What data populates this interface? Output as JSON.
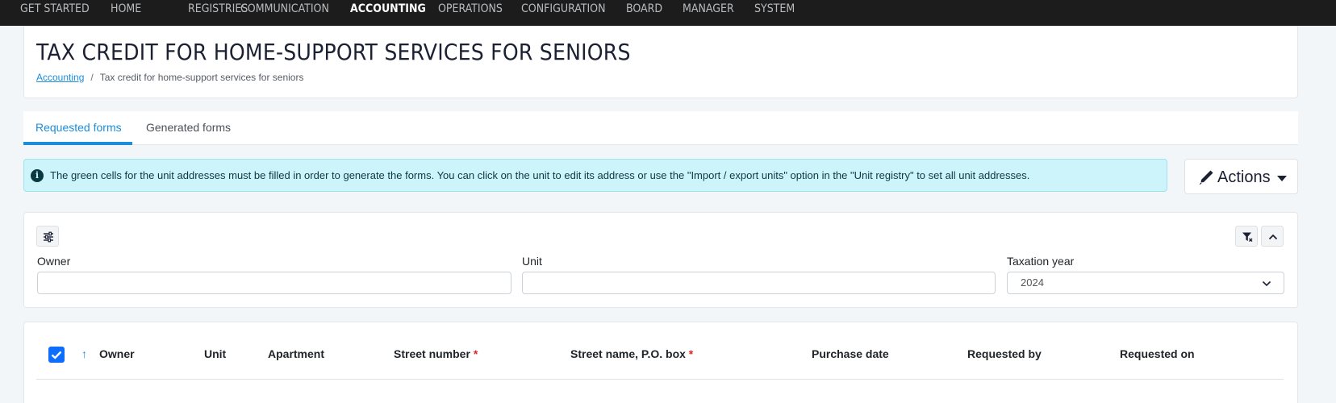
{
  "topnav": {
    "items": [
      "GET STARTED",
      "HOME",
      "REGISTRIES",
      "COMMUNICATION",
      "ACCOUNTING",
      "OPERATIONS",
      "CONFIGURATION",
      "BOARD",
      "MANAGER",
      "SYSTEM"
    ],
    "active": "ACCOUNTING"
  },
  "header": {
    "title": "TAX CREDIT FOR HOME-SUPPORT SERVICES FOR SENIORS",
    "breadcrumb_link": "Accounting",
    "breadcrumb_separator": "/",
    "breadcrumb_current": "Tax credit for home-support services for seniors"
  },
  "tabs": [
    {
      "label": "Requested forms",
      "active": true
    },
    {
      "label": "Generated forms",
      "active": false
    }
  ],
  "alert": {
    "icon": "info-icon",
    "text": "The green cells for the unit addresses must be filled in order to generate the forms. You can click on the unit to edit its address or use the \"Import / export units\" option in the \"Unit registry\" to set all unit addresses."
  },
  "actions": {
    "label": "Actions",
    "icon": "pencil-icon"
  },
  "filters": {
    "owner_label": "Owner",
    "owner_value": "",
    "unit_label": "Unit",
    "unit_value": "",
    "year_label": "Taxation year",
    "year_value": "2024"
  },
  "table": {
    "columns": [
      "Owner",
      "Unit",
      "Apartment",
      "Street number",
      "Street name, P.O. box",
      "Purchase date",
      "Requested by",
      "Requested on"
    ],
    "required_marker": "*",
    "select_all_checked": true,
    "sort_column": "Owner",
    "sort_direction": "ascending"
  },
  "colors": {
    "accent": "#1b8ddb",
    "topbar": "#1c1c1c",
    "alert_bg": "#cdf4fb",
    "required": "#e0242a",
    "checkbox": "#0d6efd"
  }
}
